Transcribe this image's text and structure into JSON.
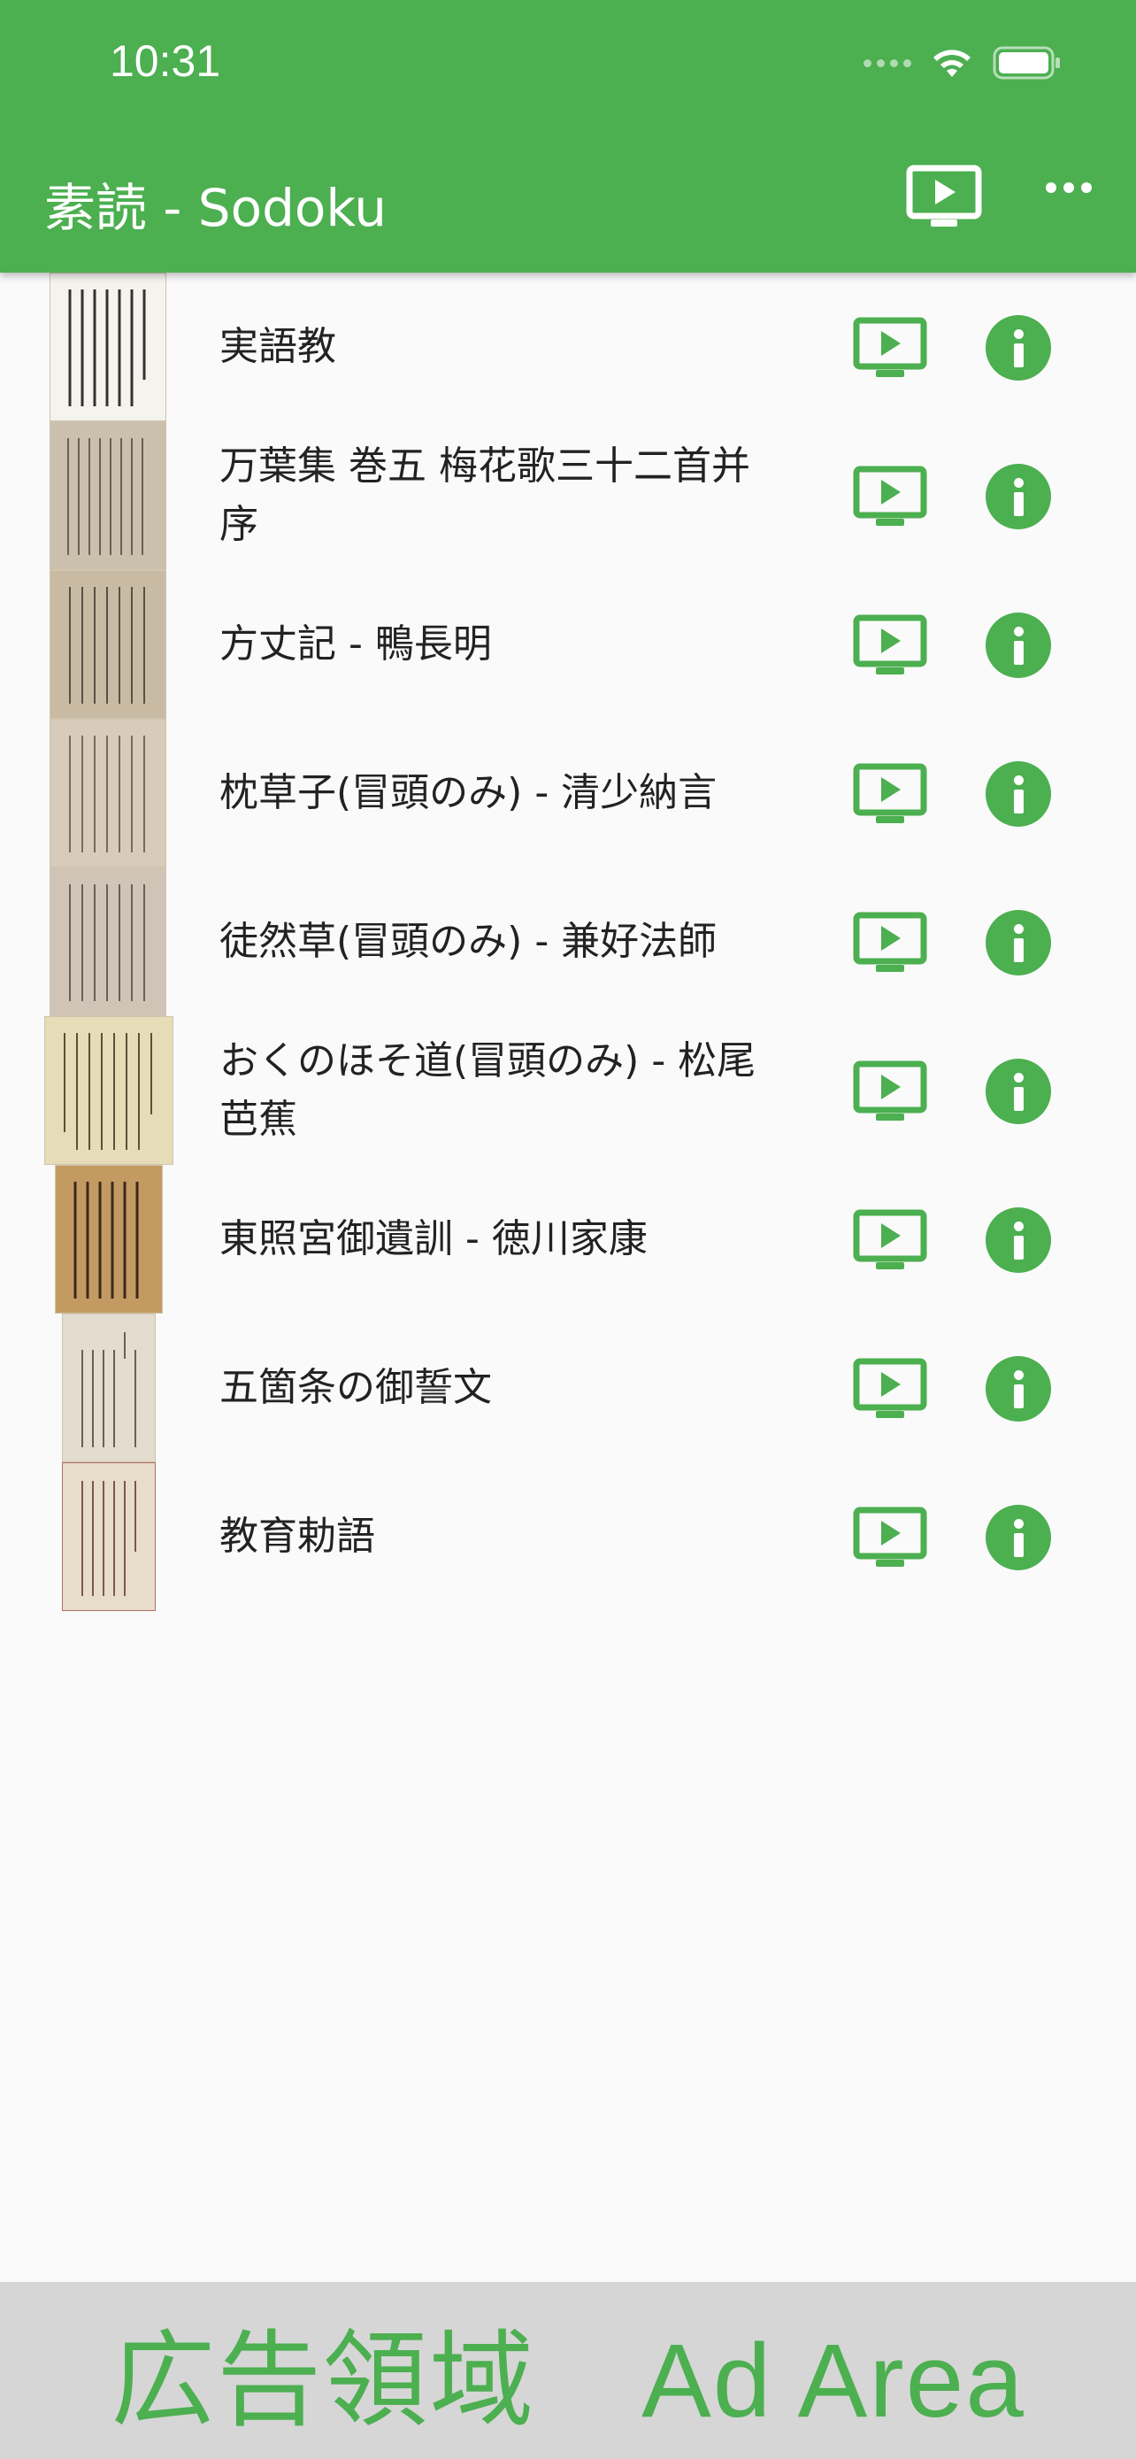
{
  "status_bar": {
    "time": "10:31",
    "icons": [
      "signal-dots-icon",
      "wifi-icon",
      "battery-icon"
    ]
  },
  "app_bar": {
    "title": "素読 - Sodoku",
    "actions": [
      "cast-play-icon",
      "more-options-icon"
    ]
  },
  "items": [
    {
      "label": "実語教",
      "thumb_color": "#f5f3ee",
      "ink": "#333333"
    },
    {
      "label": "万葉集 巻五 梅花歌三十二首并序",
      "thumb_color": "#cbbfae",
      "ink": "#6a6055"
    },
    {
      "label": "方丈記 - 鴨長明",
      "thumb_color": "#c9bba3",
      "ink": "#5a5045"
    },
    {
      "label": "枕草子(冒頭のみ) - 清少納言",
      "thumb_color": "#d8cbbb",
      "ink": "#7a6a5a"
    },
    {
      "label": "徒然草(冒頭のみ) - 兼好法師",
      "thumb_color": "#cfc4b6",
      "ink": "#6a6055"
    },
    {
      "label": "おくのほそ道(冒頭のみ) - 松尾芭蕉",
      "thumb_color": "#e6dcb8",
      "ink": "#5a5035"
    },
    {
      "label": "東照宮御遺訓 - 徳川家康",
      "thumb_color": "#c49a63",
      "ink": "#3a2a1a"
    },
    {
      "label": "五箇条の御誓文",
      "thumb_color": "#e3dccf",
      "ink": "#6a6055"
    },
    {
      "label": "教育勅語",
      "thumb_color": "#e8dccb",
      "ink": "#7a5a4a"
    }
  ],
  "ad": {
    "text": "広告領域　Ad Area"
  },
  "colors": {
    "primary": "#4caf50",
    "background": "#fafafa",
    "ad_background": "#d6d6d6"
  }
}
